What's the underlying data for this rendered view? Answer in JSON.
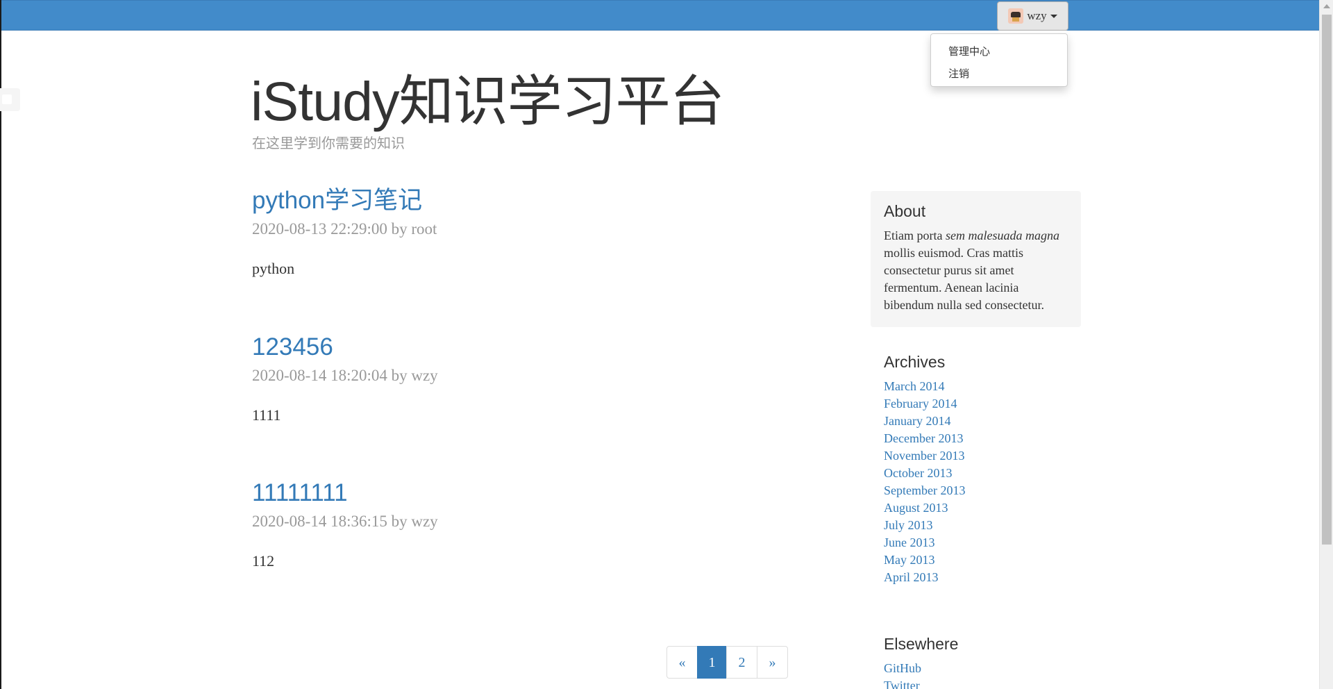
{
  "header": {
    "user_name": "wzy",
    "menu": [
      "管理中心",
      "注销"
    ]
  },
  "site": {
    "title": "iStudy知识学习平台",
    "description": "在这里学到你需要的知识"
  },
  "posts": [
    {
      "title": "python学习笔记",
      "meta": "2020-08-13 22:29:00 by root",
      "body": "python"
    },
    {
      "title": "123456",
      "meta": "2020-08-14 18:20:04 by wzy",
      "body": "1111"
    },
    {
      "title": "11111111",
      "meta": "2020-08-14 18:36:15 by wzy",
      "body": "112"
    }
  ],
  "pagination": {
    "prev": "«",
    "pages": [
      "1",
      "2"
    ],
    "next": "»",
    "current": "1"
  },
  "sidebar": {
    "about": {
      "heading": "About",
      "text_start": "Etiam porta ",
      "text_em": "sem malesuada magna",
      "text_end": " mollis euismod. Cras mattis consectetur purus sit amet fermentum. Aenean lacinia bibendum nulla sed consectetur."
    },
    "archives": {
      "heading": "Archives",
      "items": [
        "March 2014",
        "February 2014",
        "January 2014",
        "December 2013",
        "November 2013",
        "October 2013",
        "September 2013",
        "August 2013",
        "July 2013",
        "June 2013",
        "May 2013",
        "April 2013"
      ]
    },
    "elsewhere": {
      "heading": "Elsewhere",
      "items": [
        "GitHub",
        "Twitter"
      ]
    }
  },
  "colors": {
    "navbar": "#428bca",
    "link": "#337ab7",
    "muted": "#999999"
  }
}
